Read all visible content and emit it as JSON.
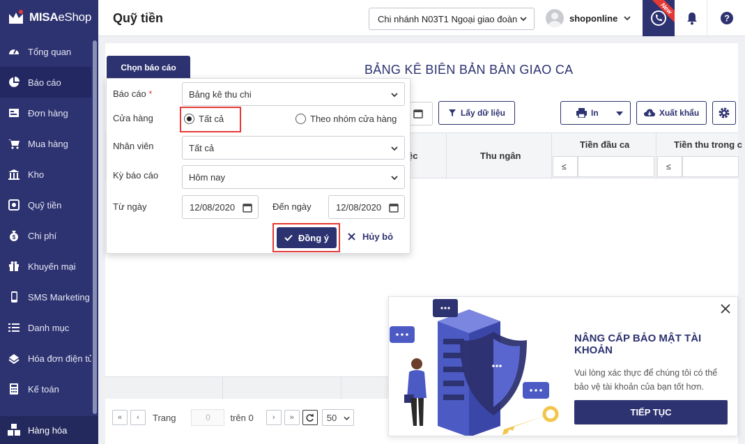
{
  "app": {
    "logo_bold": "MISA",
    "logo_rest": "eShop"
  },
  "sidebar": {
    "items": [
      {
        "label": "Tổng quan",
        "icon": "dashboard-icon"
      },
      {
        "label": "Báo cáo",
        "icon": "pie-chart-icon",
        "active": true
      },
      {
        "label": "Đơn hàng",
        "icon": "order-icon"
      },
      {
        "label": "Mua hàng",
        "icon": "cart-icon"
      },
      {
        "label": "Kho",
        "icon": "warehouse-icon"
      },
      {
        "label": "Quỹ tiền",
        "icon": "safe-icon"
      },
      {
        "label": "Chi phí",
        "icon": "money-bag-icon"
      },
      {
        "label": "Khuyến mại",
        "icon": "gift-icon"
      },
      {
        "label": "SMS Marketing",
        "icon": "phone-device-icon"
      },
      {
        "label": "Danh mục",
        "icon": "list-icon"
      },
      {
        "label": "Hóa đơn điện tử",
        "icon": "invoice-icon"
      },
      {
        "label": "Kế toán",
        "icon": "calculator-icon"
      }
    ],
    "bottom_label": "Hàng hóa"
  },
  "header": {
    "title": "Quỹ tiền",
    "branch": "Chi nhánh N03T1 Ngoại giao đoàn",
    "user": "shoponline",
    "new_badge": "New"
  },
  "report": {
    "tab_label": "Chọn báo cáo",
    "title": "BẢNG KÊ BIÊN BẢN BÀN GIAO CA",
    "fetch_label": "Lấy dữ liệu",
    "print_label": "In",
    "export_label": "Xuất khẩu",
    "columns": {
      "partial": "ệc",
      "cashier": "Thu ngân",
      "opening": "Tiền đầu ca",
      "income": "Tiền thu trong c"
    },
    "filter_op": "≤"
  },
  "form": {
    "report_label": "Báo cáo",
    "required_mark": "*",
    "report_value": "Bảng kê thu chi",
    "store_label": "Cửa hàng",
    "store_all": "Tất cả",
    "store_group": "Theo nhóm cửa hàng",
    "employee_label": "Nhân viên",
    "employee_value": "Tất cả",
    "period_label": "Kỳ báo cáo",
    "period_value": "Hôm nay",
    "from_label": "Từ ngày",
    "from_value": "12/08/2020",
    "to_label": "Đến ngày",
    "to_value": "12/08/2020",
    "ok_label": "Đồng ý",
    "cancel_label": "Hủy bỏ"
  },
  "pager": {
    "page_label": "Trang",
    "page_value": "0",
    "of_label": "trên 0",
    "page_size": "50"
  },
  "promo": {
    "title": "NÂNG CẤP BẢO MẬT TÀI KHOẢN",
    "desc": "Vui lòng xác thực để chúng tôi có thể bảo vệ tài khoản của bạn tốt hơn.",
    "button": "TIẾP TỤC"
  },
  "colors": {
    "brand": "#2d3270",
    "highlight": "#e53935"
  }
}
